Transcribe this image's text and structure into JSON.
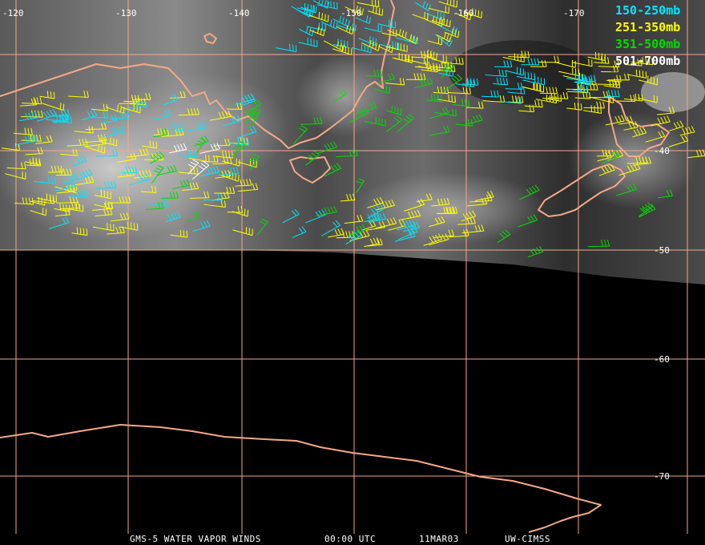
{
  "map": {
    "colors": {
      "coast": "#f4a888",
      "grid": "#f4a888",
      "band_150_250": "#00e6ff",
      "band_251_350": "#ffff00",
      "band_351_500": "#00dd00",
      "band_501_700": "#ffffff"
    },
    "lon_labels": [
      "-120",
      "-130",
      "-140",
      "-150",
      "-160",
      "-170"
    ],
    "lat_labels": [
      "-40",
      "-50",
      "-60",
      "-70"
    ],
    "legend": [
      {
        "label": "150-250mb",
        "color": "#00e6ff"
      },
      {
        "label": "251-350mb",
        "color": "#ffff00"
      },
      {
        "label": "351-500mb",
        "color": "#00dd00"
      },
      {
        "label": "501-700mb",
        "color": "#ffffff"
      }
    ],
    "footer": {
      "product": "GMS-5 WATER VAPOR WINDS",
      "time": "00:00 UTC",
      "date": "11MAR03",
      "source": "UW-CIMSS"
    }
  }
}
